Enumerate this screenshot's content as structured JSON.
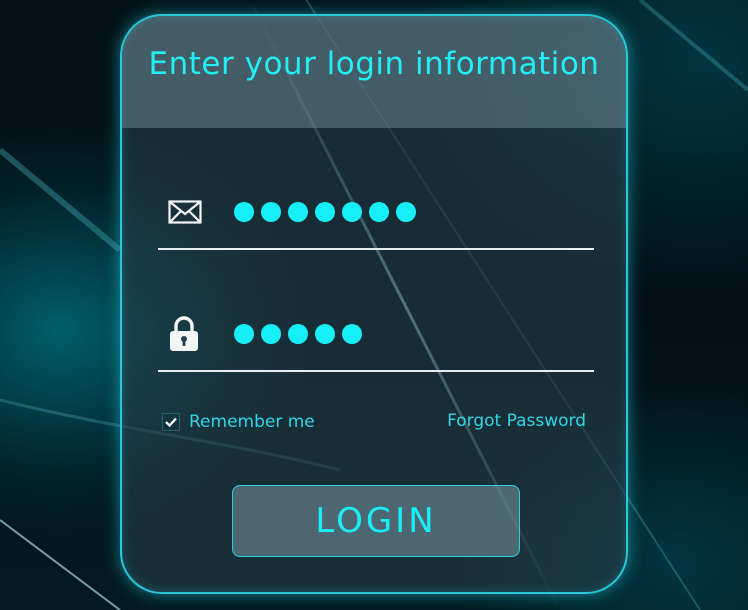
{
  "header": {
    "title": "Enter your login information"
  },
  "form": {
    "email": {
      "icon": "envelope-icon",
      "masked_length": 7
    },
    "password": {
      "icon": "lock-icon",
      "masked_length": 5
    },
    "remember": {
      "label": "Remember me",
      "checked": true,
      "icon": "checkmark-icon"
    },
    "forgot_label": "Forgot Password",
    "login_label": "LOGIN"
  },
  "colors": {
    "accent": "#16eef8",
    "border_glow": "#28c8d8",
    "link": "#2fd6e8",
    "underline": "#e6eef0"
  }
}
